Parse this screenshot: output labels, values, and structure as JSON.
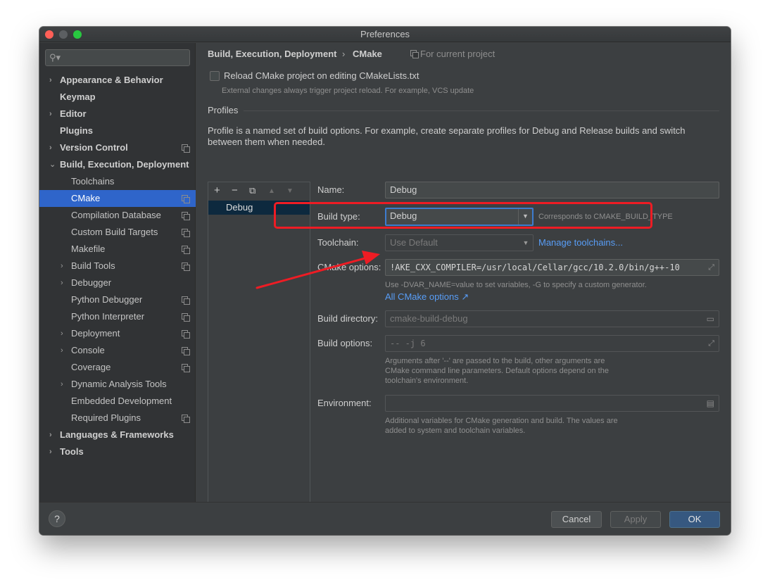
{
  "window": {
    "title": "Preferences"
  },
  "sidebar": {
    "search_placeholder": "",
    "items": [
      {
        "label": "Appearance & Behavior",
        "level": 0,
        "bold": true,
        "arrow": "›",
        "copy": false,
        "selected": false
      },
      {
        "label": "Keymap",
        "level": 0,
        "bold": true,
        "arrow": "",
        "copy": false,
        "selected": false
      },
      {
        "label": "Editor",
        "level": 0,
        "bold": true,
        "arrow": "›",
        "copy": false,
        "selected": false
      },
      {
        "label": "Plugins",
        "level": 0,
        "bold": true,
        "arrow": "",
        "copy": false,
        "selected": false
      },
      {
        "label": "Version Control",
        "level": 0,
        "bold": true,
        "arrow": "›",
        "copy": true,
        "selected": false
      },
      {
        "label": "Build, Execution, Deployment",
        "level": 0,
        "bold": true,
        "arrow": "⌄",
        "copy": false,
        "selected": false
      },
      {
        "label": "Toolchains",
        "level": 1,
        "bold": false,
        "arrow": "",
        "copy": false,
        "selected": false
      },
      {
        "label": "CMake",
        "level": 1,
        "bold": false,
        "arrow": "",
        "copy": true,
        "selected": true
      },
      {
        "label": "Compilation Database",
        "level": 1,
        "bold": false,
        "arrow": "",
        "copy": true,
        "selected": false
      },
      {
        "label": "Custom Build Targets",
        "level": 1,
        "bold": false,
        "arrow": "",
        "copy": true,
        "selected": false
      },
      {
        "label": "Makefile",
        "level": 1,
        "bold": false,
        "arrow": "",
        "copy": true,
        "selected": false
      },
      {
        "label": "Build Tools",
        "level": 1,
        "bold": false,
        "arrow": "›",
        "copy": true,
        "selected": false
      },
      {
        "label": "Debugger",
        "level": 1,
        "bold": false,
        "arrow": "›",
        "copy": false,
        "selected": false
      },
      {
        "label": "Python Debugger",
        "level": 1,
        "bold": false,
        "arrow": "",
        "copy": true,
        "selected": false
      },
      {
        "label": "Python Interpreter",
        "level": 1,
        "bold": false,
        "arrow": "",
        "copy": true,
        "selected": false
      },
      {
        "label": "Deployment",
        "level": 1,
        "bold": false,
        "arrow": "›",
        "copy": true,
        "selected": false
      },
      {
        "label": "Console",
        "level": 1,
        "bold": false,
        "arrow": "›",
        "copy": true,
        "selected": false
      },
      {
        "label": "Coverage",
        "level": 1,
        "bold": false,
        "arrow": "",
        "copy": true,
        "selected": false
      },
      {
        "label": "Dynamic Analysis Tools",
        "level": 1,
        "bold": false,
        "arrow": "›",
        "copy": false,
        "selected": false
      },
      {
        "label": "Embedded Development",
        "level": 1,
        "bold": false,
        "arrow": "",
        "copy": false,
        "selected": false
      },
      {
        "label": "Required Plugins",
        "level": 1,
        "bold": false,
        "arrow": "",
        "copy": true,
        "selected": false
      },
      {
        "label": "Languages & Frameworks",
        "level": 0,
        "bold": true,
        "arrow": "›",
        "copy": false,
        "selected": false
      },
      {
        "label": "Tools",
        "level": 0,
        "bold": true,
        "arrow": "›",
        "copy": false,
        "selected": false
      }
    ]
  },
  "header": {
    "crumb_parent": "Build, Execution, Deployment",
    "crumb_sep": "›",
    "crumb_current": "CMake",
    "scope": "For current project"
  },
  "reload": {
    "label": "Reload CMake project on editing CMakeLists.txt",
    "hint": "External changes always trigger project reload. For example, VCS update",
    "checked": false
  },
  "profiles": {
    "heading": "Profiles",
    "description_line1": "Profile is a named set of build options. For example, create separate profiles for Debug and Release builds and switch",
    "description_line2": "between them when needed.",
    "toolbar": {
      "add": "+",
      "remove": "−",
      "copy": "⧉",
      "up": "▲",
      "down": "▼"
    },
    "list": [
      "Debug"
    ]
  },
  "form": {
    "name_label": "Name:",
    "name_value": "Debug",
    "build_type_label": "Build type:",
    "build_type_value": "Debug",
    "build_type_hint": "Corresponds to CMAKE_BUILD_TYPE",
    "toolchain_label": "Toolchain:",
    "toolchain_value": "Use Default",
    "toolchain_link": "Manage toolchains...",
    "cmake_options_label": "CMake options:",
    "cmake_options_value": "!AKE_CXX_COMPILER=/usr/local/Cellar/gcc/10.2.0/bin/g++-10",
    "cmake_options_hint": "Use -DVAR_NAME=value to set variables, -G to specify a custom generator.",
    "cmake_options_link": "All CMake options ↗",
    "build_dir_label": "Build directory:",
    "build_dir_value": "cmake-build-debug",
    "build_opts_label": "Build options:",
    "build_opts_value": "-- -j 6",
    "build_opts_hint1": "Arguments after '--' are passed to the build, other arguments are",
    "build_opts_hint2": "CMake command line parameters. Default options depend on the",
    "build_opts_hint3": "toolchain's environment.",
    "env_label": "Environment:",
    "env_value": "",
    "env_hint1": "Additional variables for CMake generation and build. The values are",
    "env_hint2": "added to system and toolchain variables."
  },
  "footer": {
    "help": "?",
    "cancel": "Cancel",
    "apply": "Apply",
    "ok": "OK"
  },
  "annotation_color": "#ee1c24",
  "accent": "#2f65ca"
}
